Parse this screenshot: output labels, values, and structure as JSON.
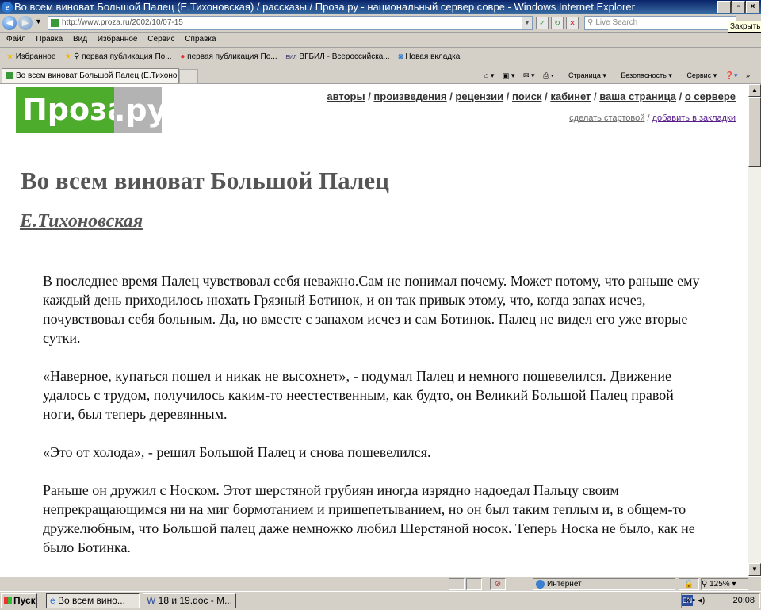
{
  "window": {
    "title": "Во всем виноват Большой Палец (Е.Тихоновская) / рассказы / Проза.ру - национальный сервер совре - Windows Internet Explorer",
    "tooltip": "Закрыть"
  },
  "address": {
    "url": "http://www.proza.ru/2002/10/07-15",
    "search_placeholder": "Live Search"
  },
  "menu": [
    "Файл",
    "Правка",
    "Вид",
    "Избранное",
    "Сервис",
    "Справка"
  ],
  "favorites": {
    "label": "Избранное",
    "items": [
      "первая публикация По...",
      "первая публикация По...",
      "ВГБИЛ - Всероссийска...",
      "Новая вкладка"
    ]
  },
  "tab": {
    "title": "Во всем виноват Большой Палец (Е.Тихоно..."
  },
  "commands": [
    "Страница",
    "Безопасность",
    "Сервис"
  ],
  "site": {
    "logo_main": "Проза",
    "logo_suffix": ".ру",
    "nav": [
      "авторы",
      "произведения",
      "рецензии",
      "поиск",
      "кабинет",
      "ваша страница",
      "о сервере"
    ],
    "subnav": [
      "сделать стартовой",
      "добавить в закладки"
    ]
  },
  "article": {
    "title": "Во всем виноват Большой Палец",
    "author": "Е.Тихоновская",
    "paragraphs": [
      "В последнее время Палец чувствовал себя неважно.Сам не понимал почему. Может потому, что раньше ему каждый день приходилось нюхать Грязный Ботинок, и он так привык этому, что, когда запах исчез, почувствовал себя больным. Да, но вместе с запахом исчез и сам Ботинок. Палец не видел его уже вторые сутки.",
      "«Наверное, купаться пошел и никак не высохнет», - подумал Палец и немного пошевелился. Движение удалось с трудом, получилось каким-то неестественным, как будто, он Великий Большой Палец правой ноги, был теперь деревянным.",
      "«Это от холода», - решил Большой Палец и снова пошевелился.",
      "Раньше он дружил с Носком. Этот шерстяной грубиян иногда изрядно надоедал Пальцу своим непрекращающимся ни на миг бормотанием и пришепетыванием, но он был таким теплым и, в общем-то дружелюбным, что Большой палец даже немножко любил Шерстяной носок. Теперь Носка не было, как не было Ботинка."
    ]
  },
  "status": {
    "zone": "Интернет",
    "zoom": "125%"
  },
  "taskbar": {
    "start": "Пуск",
    "tasks": [
      "Во всем вино...",
      "18 и 19.doc - M..."
    ],
    "lang": "EN",
    "clock": "20:08"
  }
}
